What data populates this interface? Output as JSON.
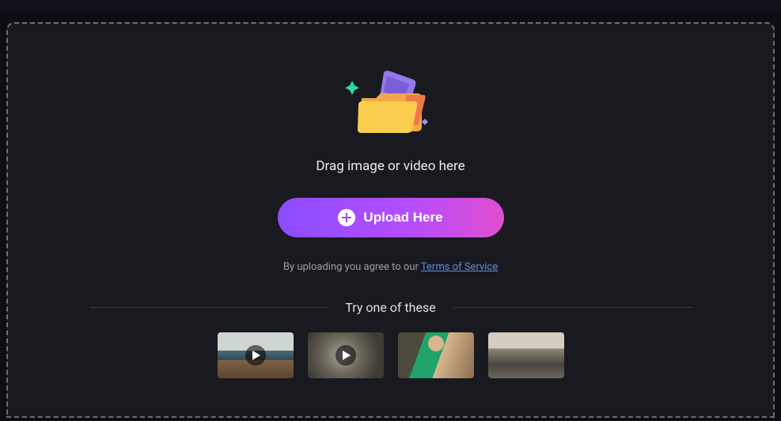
{
  "drag_text": "Drag image or video here",
  "upload_button_label": "Upload Here",
  "terms_prefix": "By uploading you agree to our ",
  "terms_link_label": "Terms of Service",
  "try_label": "Try one of these",
  "samples": [
    {
      "type": "video",
      "alt": "coastal cliff sample video"
    },
    {
      "type": "video",
      "alt": "volcano eruption sample video"
    },
    {
      "type": "image",
      "alt": "woman in green top sample image"
    },
    {
      "type": "image",
      "alt": "city street scene sample image"
    }
  ],
  "colors": {
    "button_gradient_start": "#8c4dff",
    "button_gradient_end": "#e04dd0",
    "link": "#5f8bd9"
  },
  "icons": {
    "folder": "folder-upload-icon",
    "plus": "plus-circle-icon",
    "play": "play-icon"
  }
}
